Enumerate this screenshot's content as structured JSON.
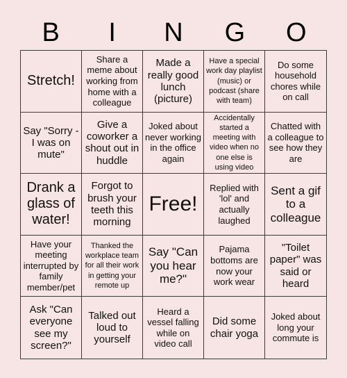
{
  "header": {
    "letters": [
      "B",
      "I",
      "N",
      "G",
      "O"
    ]
  },
  "board": {
    "cells": [
      "Stretch!",
      "Share a meme about working from home with a colleague",
      "Made a really good lunch (picture)",
      "Have a special work day playlist (music) or podcast (share with team)",
      "Do some household chores while on call",
      "Say \"Sorry - I was on mute\"",
      "Give a coworker a shout out in huddle",
      "Joked about never working in the office again",
      "Accidentally started a meeting with video when no one else is using video",
      "Chatted with a colleague to see how they are",
      "Drank a glass of water!",
      "Forgot to brush your teeth this morning",
      "Free!",
      "Replied with 'lol' and actually laughed",
      "Sent a gif to a colleague",
      "Have your meeting interrupted by family member/pet",
      "Thanked the workplace team for all their work in getting your remote up",
      "Say \"Can you hear me?\"",
      "Pajama bottoms are now your work wear",
      "\"Toilet paper\" was said or heard",
      "Ask \"Can everyone see my screen?\"",
      "Talked out loud to yourself",
      "Heard a vessel falling while on video call",
      "Did some chair yoga",
      "Joked about long your commute is"
    ]
  }
}
